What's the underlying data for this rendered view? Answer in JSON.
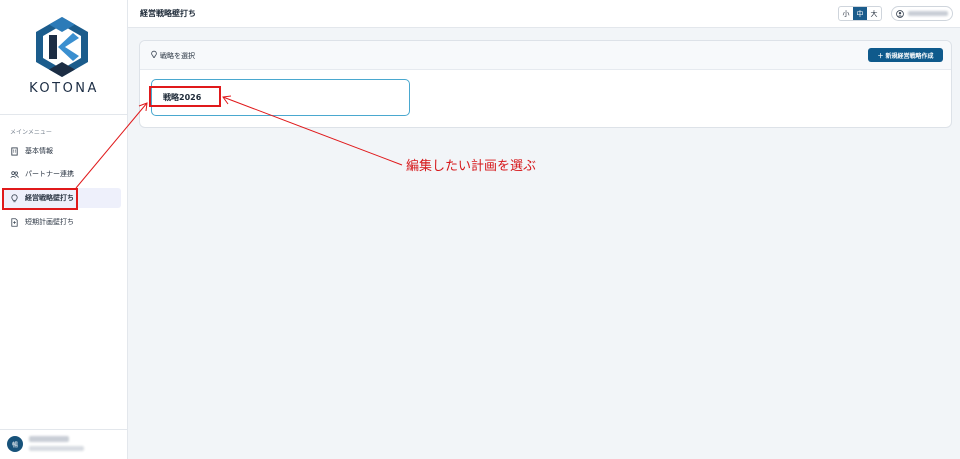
{
  "sidebar": {
    "brand": "KOTONA",
    "menu_heading": "メインメニュー",
    "items": [
      {
        "label": "基本情報",
        "icon": "building-icon"
      },
      {
        "label": "パートナー連携",
        "icon": "users-icon"
      },
      {
        "label": "経営戦略壁打ち",
        "icon": "lightbulb-icon",
        "active": true
      },
      {
        "label": "短期計画壁打ち",
        "icon": "document-icon"
      }
    ],
    "avatar_initial": "暢"
  },
  "header": {
    "title": "経営戦略壁打ち",
    "font_sizes": [
      "小",
      "中",
      "大"
    ],
    "selected_font_size": "中"
  },
  "card": {
    "title": "戦略を選択",
    "new_button": "＋ 新規経営戦略作成",
    "strategies": [
      {
        "label": "戦略2026"
      }
    ]
  },
  "annotation": {
    "text": "編集したい計画を選ぶ",
    "color": "#e0191b"
  },
  "colors": {
    "accent": "#0f5a8c",
    "active_bg": "#eef0fb"
  }
}
